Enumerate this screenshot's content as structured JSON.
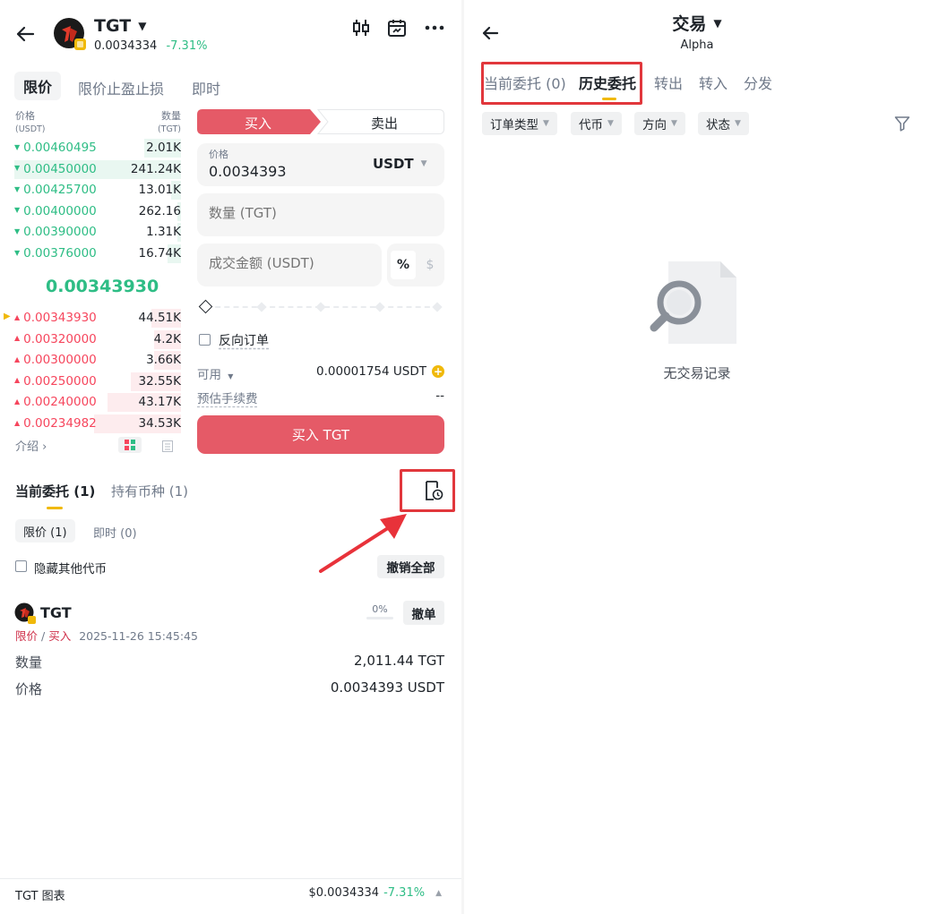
{
  "left": {
    "header": {
      "back_icon": "back-arrow-icon",
      "symbol": "TGT",
      "price": "0.0034334",
      "change": "-7.31%",
      "icons": [
        "candlestick-icon",
        "calendar-chart-icon",
        "more-icon"
      ]
    },
    "order_tabs": [
      "限价",
      "限价止盈止损",
      "即时"
    ],
    "orderbook": {
      "price_header": "价格",
      "price_unit": "(USDT)",
      "qty_header": "数量",
      "qty_unit": "(TGT)",
      "asks": [
        {
          "price": "0.00460495",
          "qty": "2.01K",
          "depth": 0.22
        },
        {
          "price": "0.00450000",
          "qty": "241.24K",
          "depth": 1.0
        },
        {
          "price": "0.00425700",
          "qty": "13.01K",
          "depth": 0.06
        },
        {
          "price": "0.00400000",
          "qty": "262.16",
          "depth": 0.02
        },
        {
          "price": "0.00390000",
          "qty": "1.31K",
          "depth": 0.02
        },
        {
          "price": "0.00376000",
          "qty": "16.74K",
          "depth": 0.08
        }
      ],
      "mid_price": "0.00343930",
      "bids": [
        {
          "price": "0.00343930",
          "qty": "44.51K",
          "depth": 0.18
        },
        {
          "price": "0.00320000",
          "qty": "4.2K",
          "depth": 0.16
        },
        {
          "price": "0.00300000",
          "qty": "3.66K",
          "depth": 0.16
        },
        {
          "price": "0.00250000",
          "qty": "32.55K",
          "depth": 0.3
        },
        {
          "price": "0.00240000",
          "qty": "43.17K",
          "depth": 0.44
        },
        {
          "price": "0.00234982",
          "qty": "34.53K",
          "depth": 0.52
        }
      ],
      "intro": "介绍 ›"
    },
    "trade": {
      "buy_tab": "买入",
      "sell_tab": "卖出",
      "price_label": "价格",
      "price_value": "0.0034393",
      "price_unit": "USDT",
      "qty_placeholder": "数量 (TGT)",
      "amount_placeholder": "成交金额 (USDT)",
      "pct_symbol": "%",
      "dollar_symbol": "$",
      "slider_value": 0,
      "reverse_order": "反向订单",
      "available_label": "可用",
      "available_value": "0.00001754 USDT",
      "fee_label": "预估手续费",
      "fee_value": "--",
      "submit": "买入 TGT"
    },
    "orders_section": {
      "tab_current": "当前委托 (1)",
      "tab_holdings": "持有币种 (1)",
      "filter_limit": "限价 (1)",
      "filter_instant": "即时 (0)",
      "hide_other": "隐藏其他代币",
      "cancel_all": "撤销全部",
      "order": {
        "symbol": "TGT",
        "progress": "0%",
        "cancel": "撤单",
        "type_limit": "限价",
        "separator": " / ",
        "type_side": "买入",
        "time": "2025-11-26 15:45:45",
        "qty_label": "数量",
        "qty_value": "2,011.44 TGT",
        "price_label": "价格",
        "price_value": "0.0034393 USDT"
      }
    },
    "footer": {
      "label": "TGT 图表",
      "price": "$0.0034334",
      "change": "-7.31%"
    }
  },
  "right": {
    "title": "交易",
    "subtitle": "Alpha",
    "tabs": [
      "当前委托 (0)",
      "历史委托",
      "转出",
      "转入",
      "分发"
    ],
    "filters": [
      "订单类型",
      "代币",
      "方向",
      "状态"
    ],
    "empty_text": "无交易记录"
  },
  "colors": {
    "accent_red": "#e55a67",
    "green": "#2ebd85",
    "highlight_box": "#e1373c",
    "yellow": "#f0b90b"
  }
}
